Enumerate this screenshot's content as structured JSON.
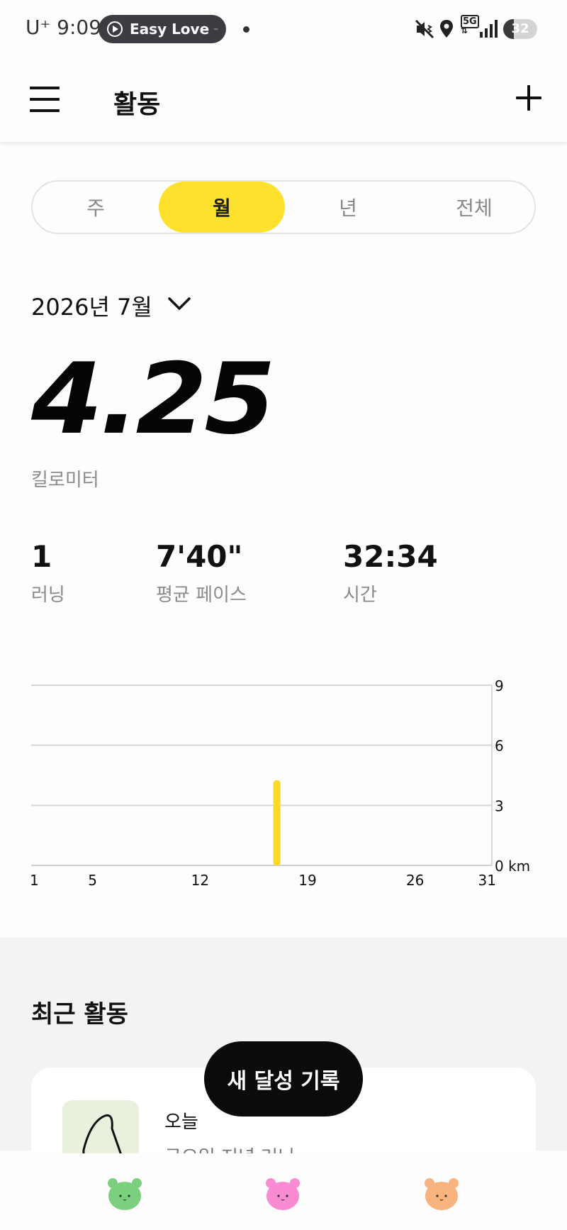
{
  "status_bar": {
    "carrier_time": "U⁺ 9:09",
    "media_pill": "Easy Love",
    "network": "5G",
    "battery": "32",
    "battery_fraction": 0.32
  },
  "header": {
    "title": "활동",
    "menu_icon": "menu-icon",
    "add_icon": "plus-icon"
  },
  "segments": {
    "tabs": [
      "주",
      "월",
      "년",
      "전체"
    ],
    "selected": "월"
  },
  "period": {
    "label": "2026년 7월"
  },
  "summary": {
    "distance": "4.25",
    "unit": "킬로미터",
    "stats": [
      {
        "value": "1",
        "label": "러닝"
      },
      {
        "value": "7'40\"",
        "label": "평균 페이스"
      },
      {
        "value": "32:34",
        "label": "시간"
      }
    ]
  },
  "chart_data": {
    "type": "bar",
    "x": [
      1,
      5,
      12,
      19,
      26,
      31
    ],
    "x_tick_labels": [
      "1",
      "5",
      "12",
      "19",
      "26",
      "31"
    ],
    "y_ticks": [
      0,
      3,
      6,
      9
    ],
    "y_tick_labels": [
      "0 km",
      "3",
      "6",
      "9"
    ],
    "ylim": [
      0,
      9
    ],
    "xlim": [
      1,
      31
    ],
    "values": [
      {
        "day": 17,
        "km": 4.25
      }
    ],
    "grid": true,
    "bar_color": "#fbd92b"
  },
  "recent": {
    "title": "최근 활동",
    "card": {
      "date": "오늘",
      "name": "금요일 저녁 러닝"
    }
  },
  "fab": {
    "label": "새 달성 기록"
  },
  "bottom_nav": [
    {
      "icon": "green-bear-icon",
      "color": "#7ccf7f"
    },
    {
      "icon": "pink-bear-icon",
      "color": "#f98bd3"
    },
    {
      "icon": "orange-bear-icon",
      "color": "#f8b37e"
    }
  ],
  "colors": {
    "accent": "#fde12d",
    "text": "#111111",
    "muted": "#8a8a8a"
  }
}
